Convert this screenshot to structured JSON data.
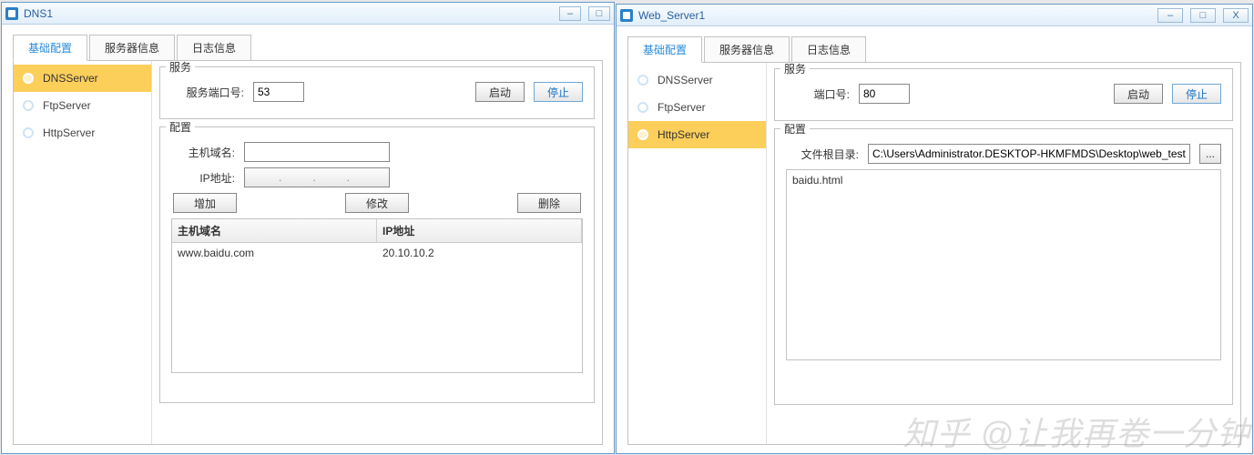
{
  "watermark": "知乎 @让我再卷一分钟",
  "common": {
    "tabs": {
      "basic": "基础配置",
      "server": "服务器信息",
      "log": "日志信息"
    },
    "sidebar": [
      "DNSServer",
      "FtpServer",
      "HttpServer"
    ],
    "service_legend": "服务",
    "config_legend": "配置",
    "start": "启动",
    "stop": "停止"
  },
  "dns": {
    "title": "DNS1",
    "port_label": "服务端口号:",
    "port_value": "53",
    "host_label": "主机域名:",
    "host_value": "",
    "ip_label": "IP地址:",
    "ip_value": "",
    "add": "增加",
    "edit": "修改",
    "del": "删除",
    "col_host": "主机域名",
    "col_ip": "IP地址",
    "rows": [
      {
        "host": "www.baidu.com",
        "ip": "20.10.10.2"
      }
    ]
  },
  "web": {
    "title": "Web_Server1",
    "port_label": "端口号:",
    "port_value": "80",
    "root_label": "文件根目录:",
    "root_value": "C:\\Users\\Administrator.DESKTOP-HKMFMDS\\Desktop\\web_test",
    "browse": "...",
    "files": [
      "baidu.html"
    ]
  }
}
